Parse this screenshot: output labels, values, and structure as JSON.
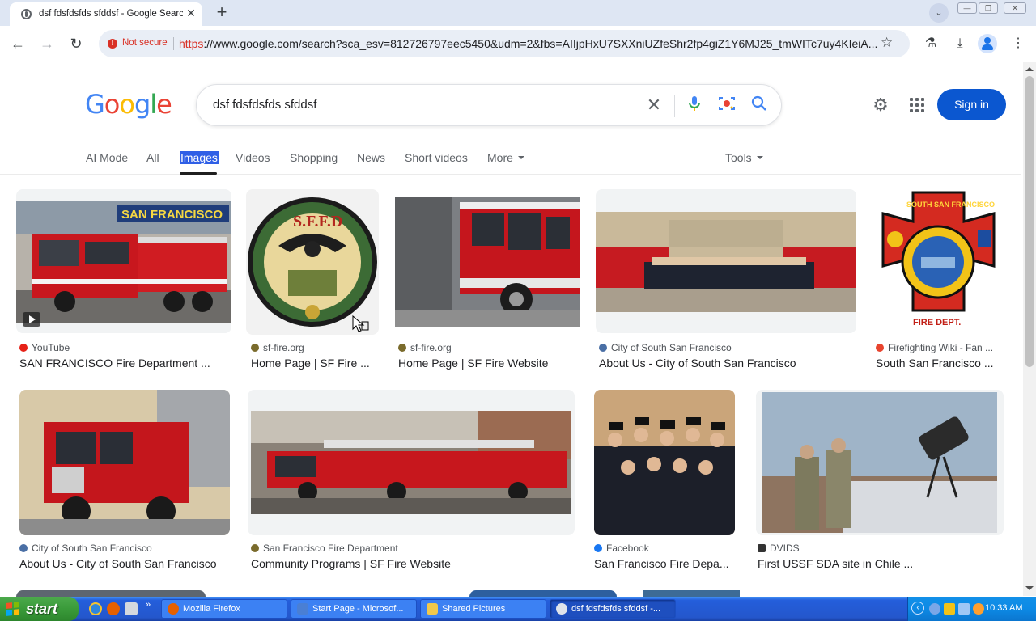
{
  "browser": {
    "tab_title": "dsf fdsfdsfds sfddsf - Google Search",
    "tab_close": "✕",
    "new_tab": "+",
    "tab_search": "⌄",
    "url_scheme": "https",
    "url_rest": "://www.google.com/search?sca_esv=812726797eec5450&udm=2&fbs=AIIjpHxU7SXXniUZfeShr2fp4giZ1Y6MJ25_tmWITc7uy4KIeiA...",
    "security_label": "Not secure",
    "back": "←",
    "forward": "→",
    "reload": "↻",
    "bookmark": "☆",
    "labs": "⚗",
    "download": "⤓",
    "menu": "⋮",
    "win_min": "—",
    "win_restore": "❐",
    "win_close": "✕"
  },
  "google": {
    "query": "dsf fdsfdsfds sfddsf",
    "clear": "✕",
    "settings": "⚙",
    "signin_label": "Sign in"
  },
  "filters": {
    "ai_mode": "AI Mode",
    "all": "All",
    "images": "Images",
    "videos": "Videos",
    "shopping": "Shopping",
    "news": "News",
    "short_videos": "Short videos",
    "more": "More",
    "tools": "Tools"
  },
  "results": [
    {
      "source": "YouTube",
      "title": "SAN FRANCISCO Fire Department ...",
      "icon_color": "#e62117"
    },
    {
      "source": "sf-fire.org",
      "title": "Home Page | SF Fire ...",
      "icon_color": "#7a6b2c"
    },
    {
      "source": "sf-fire.org",
      "title": "Home Page | SF Fire Website",
      "icon_color": "#7a6b2c"
    },
    {
      "source": "City of South San Francisco",
      "title": "About Us - City of South San Francisco",
      "icon_color": "#4a6fa5"
    },
    {
      "source": "Firefighting Wiki - Fan ...",
      "title": "South San Francisco ...",
      "icon_color": "#e8442e"
    },
    {
      "source": "City of South San Francisco",
      "title": "About Us - City of South San Francisco",
      "icon_color": "#4a6fa5"
    },
    {
      "source": "San Francisco Fire Department",
      "title": "Community Programs | SF Fire Website",
      "icon_color": "#7a6b2c"
    },
    {
      "source": "Facebook",
      "title": "San Francisco Fire Depa...",
      "icon_color": "#1877f2"
    },
    {
      "source": "DVIDS",
      "title": "First USSF SDA site in Chile ...",
      "icon_color": "#333333"
    }
  ],
  "taskbar": {
    "start_label": "start",
    "tasks": [
      {
        "label": "Mozilla Firefox"
      },
      {
        "label": "Start Page - Microsof..."
      },
      {
        "label": "Shared Pictures"
      },
      {
        "label": "dsf fdsfdsfds sfddsf -..."
      }
    ],
    "clock": "10:33 AM"
  },
  "colors": {
    "accent": "#0b57d0",
    "taskbar_blue": "#245edb",
    "start_green": "#3a9b3a"
  }
}
